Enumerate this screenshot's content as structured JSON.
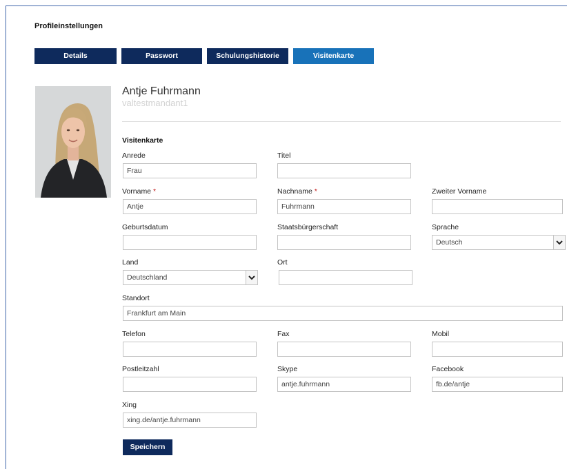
{
  "page": {
    "title": "Profileinstellungen"
  },
  "tabs": [
    {
      "label": "Details"
    },
    {
      "label": "Passwort"
    },
    {
      "label": "Schulungshistorie"
    },
    {
      "label": "Visitenkarte"
    }
  ],
  "user": {
    "name": "Antje Fuhrmann",
    "tenant": "valtestmandant1"
  },
  "form": {
    "section_title": "Visitenkarte",
    "anrede": {
      "label": "Anrede",
      "value": "Frau"
    },
    "titel": {
      "label": "Titel",
      "value": ""
    },
    "vorname": {
      "label": "Vorname",
      "required_mark": "*",
      "value": "Antje"
    },
    "nachname": {
      "label": "Nachname",
      "required_mark": "*",
      "value": "Fuhrmann"
    },
    "zweiter_vorname": {
      "label": "Zweiter Vorname",
      "value": ""
    },
    "geburtsdatum": {
      "label": "Geburtsdatum",
      "value": ""
    },
    "staatsbuergerschaft": {
      "label": "Staatsbürgerschaft",
      "value": ""
    },
    "sprache": {
      "label": "Sprache",
      "value": "Deutsch"
    },
    "land": {
      "label": "Land",
      "value": "Deutschland"
    },
    "ort": {
      "label": "Ort",
      "value": ""
    },
    "standort": {
      "label": "Standort",
      "value": "Frankfurt am Main"
    },
    "telefon": {
      "label": "Telefon",
      "value": ""
    },
    "fax": {
      "label": "Fax",
      "value": ""
    },
    "mobil": {
      "label": "Mobil",
      "value": ""
    },
    "postleitzahl": {
      "label": "Postleitzahl",
      "value": ""
    },
    "skype": {
      "label": "Skype",
      "value": "antje.fuhrmann"
    },
    "facebook": {
      "label": "Facebook",
      "value": "fb.de/antje"
    },
    "xing": {
      "label": "Xing",
      "value": "xing.de/antje.fuhrmann"
    },
    "save_label": "Speichern"
  },
  "colors": {
    "primary": "#0e2a5c",
    "active_tab": "#1872b9",
    "required": "#c01818",
    "frame": "#3b63a8"
  },
  "icons": {
    "dropdown": "chevron-down-icon"
  }
}
